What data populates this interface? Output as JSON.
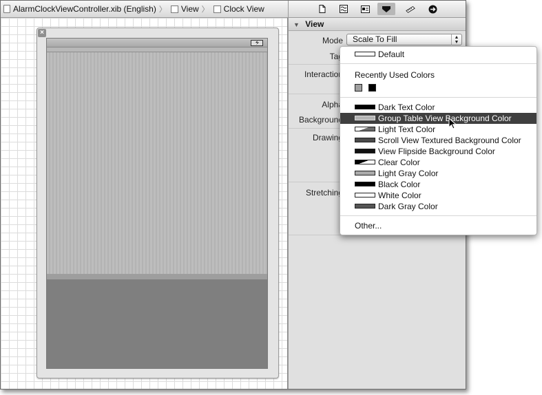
{
  "breadcrumb": {
    "items": [
      {
        "label": "AlarmClockViewController.xib (English)",
        "icon": "xib-file-icon"
      },
      {
        "label": "View",
        "icon": "view-icon"
      },
      {
        "label": "Clock View",
        "icon": "view-icon"
      }
    ],
    "separator": "〉"
  },
  "inspector_toolbar": {
    "icons": [
      "file-inspector-icon",
      "quick-help-icon",
      "identity-inspector-icon",
      "attributes-inspector-icon",
      "size-inspector-icon",
      "connections-inspector-icon"
    ],
    "active": "attributes-inspector-icon"
  },
  "canvas": {
    "close_glyph": "×"
  },
  "inspector": {
    "section_title": "View",
    "labels": {
      "mode": "Mode",
      "tag": "Tag",
      "interaction": "Interaction",
      "alpha": "Alpha",
      "background": "Background",
      "drawing": "Drawing",
      "stretching": "Stretching"
    },
    "mode_value": "Scale To Fill"
  },
  "color_menu": {
    "default_label": "Default",
    "recent_heading": "Recently Used Colors",
    "recent_colors": [
      "#a0a0a0",
      "#000000"
    ],
    "items": [
      {
        "label": "Dark Text Color",
        "swatch": "#000000",
        "highlighted": false
      },
      {
        "label": "Group Table View Background Color",
        "swatch": "#b4b4b4",
        "highlighted": true
      },
      {
        "label": "Light Text Color",
        "swatch": "#808080",
        "highlighted": false
      },
      {
        "label": "Scroll View Textured Background Color",
        "swatch": "#4a4a4a",
        "highlighted": false
      },
      {
        "label": "View Flipside Background Color",
        "swatch": "#111111",
        "highlighted": false
      },
      {
        "label": "Clear Color",
        "swatch": "#000000",
        "highlighted": false
      },
      {
        "label": "Light Gray Color",
        "swatch": "#aaaaaa",
        "highlighted": false
      },
      {
        "label": "Black Color",
        "swatch": "#000000",
        "highlighted": false
      },
      {
        "label": "White Color",
        "swatch": "#ffffff",
        "highlighted": false
      },
      {
        "label": "Dark Gray Color",
        "swatch": "#555555",
        "highlighted": false
      }
    ],
    "other_label": "Other..."
  }
}
